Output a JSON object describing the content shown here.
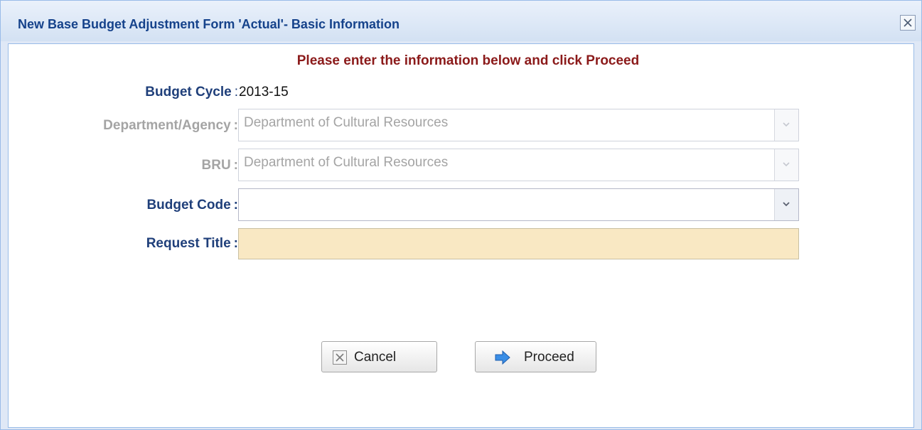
{
  "dialog": {
    "title": "New Base Budget Adjustment Form 'Actual'- Basic Information",
    "close_icon": "close-icon"
  },
  "form": {
    "instruction": "Please enter the information below and click Proceed",
    "budget_cycle": {
      "label": "Budget Cycle",
      "colon": ":",
      "value": "2013-15"
    },
    "department": {
      "label": "Department/Agency",
      "colon": ":",
      "value": "Department of Cultural Resources",
      "disabled": true
    },
    "bru": {
      "label": "BRU",
      "colon": ":",
      "value": "Department of Cultural Resources",
      "disabled": true
    },
    "budget_code": {
      "label": "Budget Code",
      "colon": ":",
      "value": ""
    },
    "request_title": {
      "label": "Request Title",
      "colon": ":",
      "value": ""
    }
  },
  "buttons": {
    "cancel": {
      "label": "Cancel",
      "icon": "cancel-x-icon"
    },
    "proceed": {
      "label": "Proceed",
      "icon": "arrow-right-icon"
    }
  },
  "colors": {
    "title": "#15428b",
    "instruction": "#8b1a1a",
    "label": "#1f3f7a",
    "required_field_bg": "#f9e8c3"
  }
}
